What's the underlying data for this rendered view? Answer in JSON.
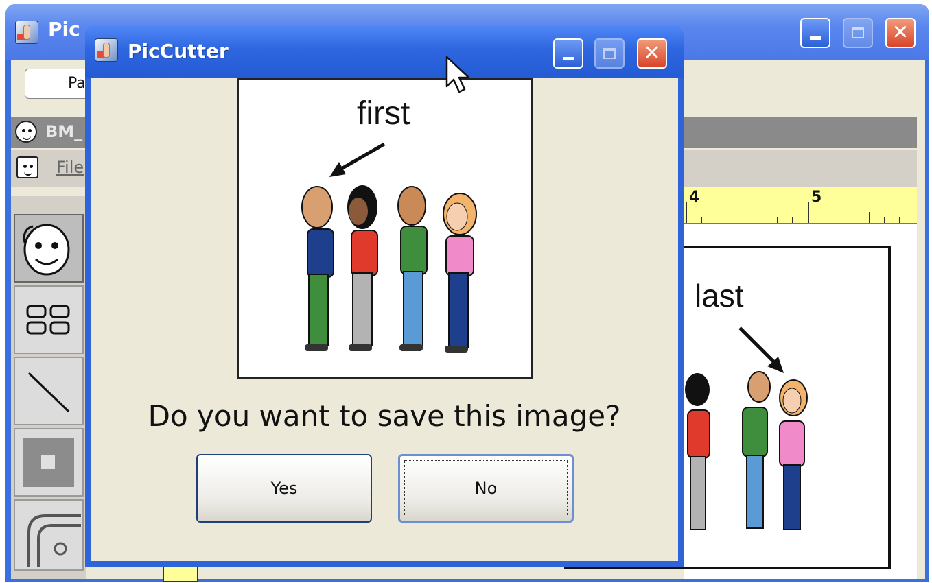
{
  "main_window": {
    "title": "Pic",
    "button_partial": "Pa",
    "subtitle": "BM_",
    "menu_file": "File",
    "ruler_numbers": [
      "4",
      "5"
    ],
    "canvas_image_label": "last"
  },
  "dialog": {
    "title": "PicCutter",
    "preview_label": "first",
    "question": "Do you want to save this image?",
    "yes_label": "Yes",
    "no_label": "No"
  },
  "icons": [
    "app-icon",
    "minimize-icon",
    "maximize-icon",
    "close-icon",
    "face-icon",
    "arrow-cursor-icon"
  ],
  "colors": {
    "titlebar_blue": "#2e66e0",
    "close_red": "#d8452a",
    "dialog_background": "#ece9d8",
    "ruler_yellow": "#ffff99"
  }
}
